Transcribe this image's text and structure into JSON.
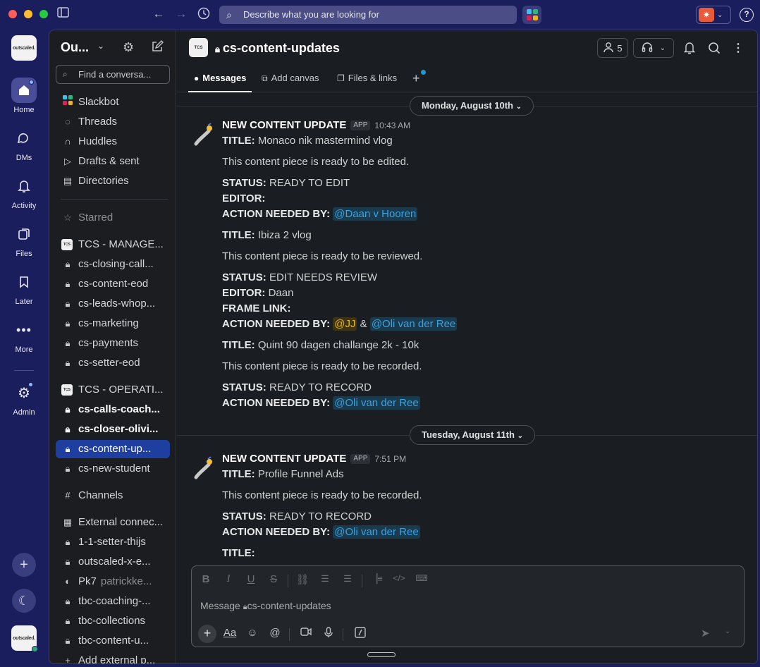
{
  "titlebar": {
    "search_placeholder": "Describe what you are looking for"
  },
  "rail": {
    "items": [
      {
        "label": "Home",
        "icon": "home-icon"
      },
      {
        "label": "DMs",
        "icon": "dms-icon"
      },
      {
        "label": "Activity",
        "icon": "bell-icon"
      },
      {
        "label": "Files",
        "icon": "files-icon"
      },
      {
        "label": "Later",
        "icon": "bookmark-icon"
      },
      {
        "label": "More",
        "icon": "more-icon"
      },
      {
        "label": "Admin",
        "icon": "gear-icon"
      }
    ],
    "workspace_logo": "outscaled."
  },
  "sidebar": {
    "workspace_name": "Ou...",
    "find_placeholder": "Find a conversa...",
    "nav": [
      "Slackbot",
      "Threads",
      "Huddles",
      "Drafts & sent",
      "Directories"
    ],
    "starred": "Starred",
    "team1": "TCS - MANAGE...",
    "team1_channels": [
      "cs-closing-call...",
      "cs-content-eod",
      "cs-leads-whop...",
      "cs-marketing",
      "cs-payments",
      "cs-setter-eod"
    ],
    "team2": "TCS - OPERATI...",
    "team2_channels": [
      "cs-calls-coach...",
      "cs-closer-olivi...",
      "cs-content-up...",
      "cs-new-student"
    ],
    "channels": "Channels",
    "external": "External connec...",
    "external_channels": [
      "1-1-setter-thijs",
      "outscaled-x-e..."
    ],
    "dm_name": "Pk7",
    "dm_sub": "patrickke...",
    "external_channels2": [
      "tbc-coaching-...",
      "tbc-collections",
      "tbc-content-u..."
    ],
    "add_external": "Add external p..."
  },
  "channel": {
    "name": "cs-content-updates",
    "member_count": "5",
    "tabs": [
      "Messages",
      "Add canvas",
      "Files & links"
    ]
  },
  "messages": {
    "day1": "Monday, August 10th",
    "day2": "Tuesday, August 11th",
    "sender": "NEW CONTENT UPDATE",
    "app_badge": "APP",
    "time1": "10:43 AM",
    "time2": "7:51 PM",
    "title_label": "TITLE:",
    "status_label": "STATUS:",
    "editor_label": "EDITOR:",
    "frame_label": "FRAME LINK:",
    "action_label": "ACTION NEEDED BY:",
    "m1": {
      "title": "Monaco nik mastermind vlog",
      "desc": "This content piece is ready to be edited.",
      "status": "READY TO EDIT",
      "mention": "@Daan v Hooren"
    },
    "m2": {
      "title": "Ibiza 2 vlog",
      "desc": "This content piece is ready to be reviewed.",
      "status": "EDIT NEEDS REVIEW",
      "editor": "Daan",
      "mention1": "@JJ",
      "amp": "&",
      "mention2": "@Oli van der Ree"
    },
    "m3": {
      "title": "Quint 90 dagen challange 2k - 10k",
      "desc": "This content piece is ready to be recorded.",
      "status": "READY TO RECORD",
      "mention": "@Oli van der Ree"
    },
    "m4": {
      "title": "Profile Funnel Ads",
      "desc": "This content piece is ready to be recorded.",
      "status": "READY TO RECORD",
      "mention": "@Oli van der Ree"
    }
  },
  "composer": {
    "placeholder_prefix": "Message",
    "placeholder_channel": "cs-content-updates"
  },
  "colors": {
    "rail_bg": "#1b1e5c",
    "selected_channel": "#1e3fa0",
    "mention_blue": "#3aa3e3",
    "mention_yellow": "#e8b524"
  }
}
